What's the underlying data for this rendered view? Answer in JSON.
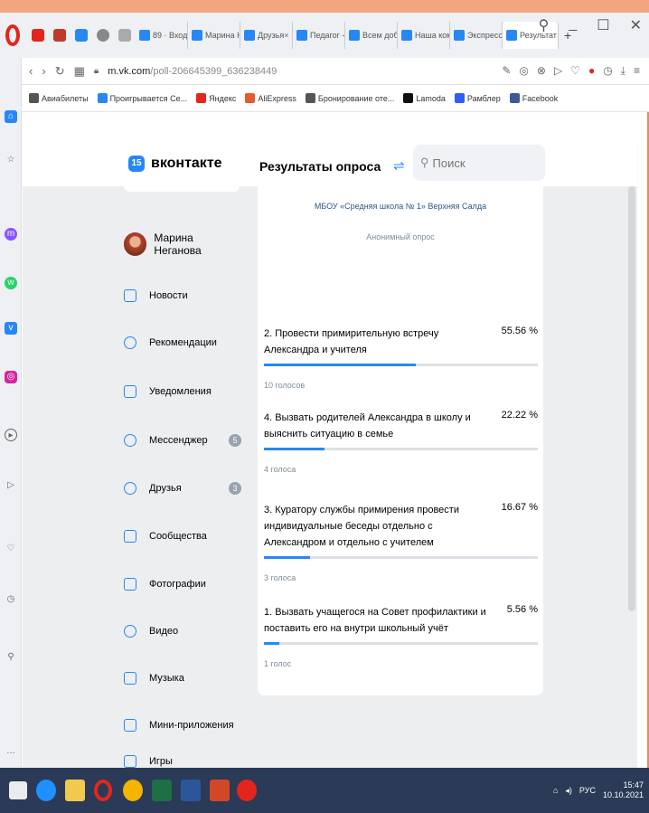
{
  "browser": {
    "tabs": [
      {
        "label": "89 · Входя"
      },
      {
        "label": "Марина Н"
      },
      {
        "label": "Друзья"
      },
      {
        "label": "Педагог -"
      },
      {
        "label": "Всем добр"
      },
      {
        "label": "Наша ком"
      },
      {
        "label": "Экспресс"
      },
      {
        "label": "Результат",
        "active": true
      }
    ],
    "new_tab": "+",
    "url_host": "m.vk.com",
    "url_path": "/poll-206645399_636238449",
    "bookmarks": [
      {
        "label": "Авиабилеты",
        "color": "#555555"
      },
      {
        "label": "Проигрывается Се...",
        "color": "#2787f5"
      },
      {
        "label": "Яндекс",
        "color": "#e3261b"
      },
      {
        "label": "AliExpress",
        "color": "#e55b2d"
      },
      {
        "label": "Бронирование оте...",
        "color": "#555555"
      },
      {
        "label": "Lamoda",
        "color": "#111111"
      },
      {
        "label": "Рамблер",
        "color": "#315efb"
      },
      {
        "label": "Facebook",
        "color": "#3b5998"
      }
    ]
  },
  "vk": {
    "logo_badge": "15",
    "logo_text": "вконтакте",
    "page_title": "Результаты опроса",
    "search_placeholder": "Поиск",
    "user_name": "Марина Неганова",
    "menu": [
      {
        "label": "Новости",
        "icon": "news-icon"
      },
      {
        "label": "Рекомендации",
        "icon": "recommendations-icon"
      },
      {
        "label": "Уведомления",
        "icon": "bell-icon"
      },
      {
        "label": "Мессенджер",
        "icon": "messenger-icon",
        "badge": "5"
      },
      {
        "label": "Друзья",
        "icon": "friends-icon",
        "badge": "3"
      },
      {
        "label": "Сообщества",
        "icon": "communities-icon"
      },
      {
        "label": "Фотографии",
        "icon": "photos-icon"
      },
      {
        "label": "Видео",
        "icon": "video-icon"
      },
      {
        "label": "Музыка",
        "icon": "music-icon"
      },
      {
        "label": "Мини-приложения",
        "icon": "mini-apps-icon"
      },
      {
        "label": "Игры",
        "icon": "games-icon"
      }
    ]
  },
  "poll": {
    "group": "МБОУ «Средняя школа № 1» Верхняя Салда",
    "type_label": "Анонимный опрос",
    "options": [
      {
        "text": "2. Провести примирительную встречу Александра и учителя",
        "percent_label": "55.56 %",
        "share": 0.5556,
        "votes": "10 голосов"
      },
      {
        "text": "4. Вызвать родителей Александра в школу и выяснить ситуацию в семье",
        "percent_label": "22.22 %",
        "share": 0.2222,
        "votes": "4 голоса"
      },
      {
        "text": "3. Куратору службы примирения провести индивидуальные беседы отдельно с Александром и отдельно с учителем",
        "percent_label": "16.67 %",
        "share": 0.1667,
        "votes": "3 голоса"
      },
      {
        "text": "1. Вызвать учащегося на Совет профилактики и поставить его на внутри школьный учёт",
        "percent_label": "5.56 %",
        "share": 0.0556,
        "votes": "1 голос"
      }
    ]
  },
  "taskbar": {
    "lang": "РУС",
    "time": "15:47",
    "date": "10.10.2021"
  }
}
